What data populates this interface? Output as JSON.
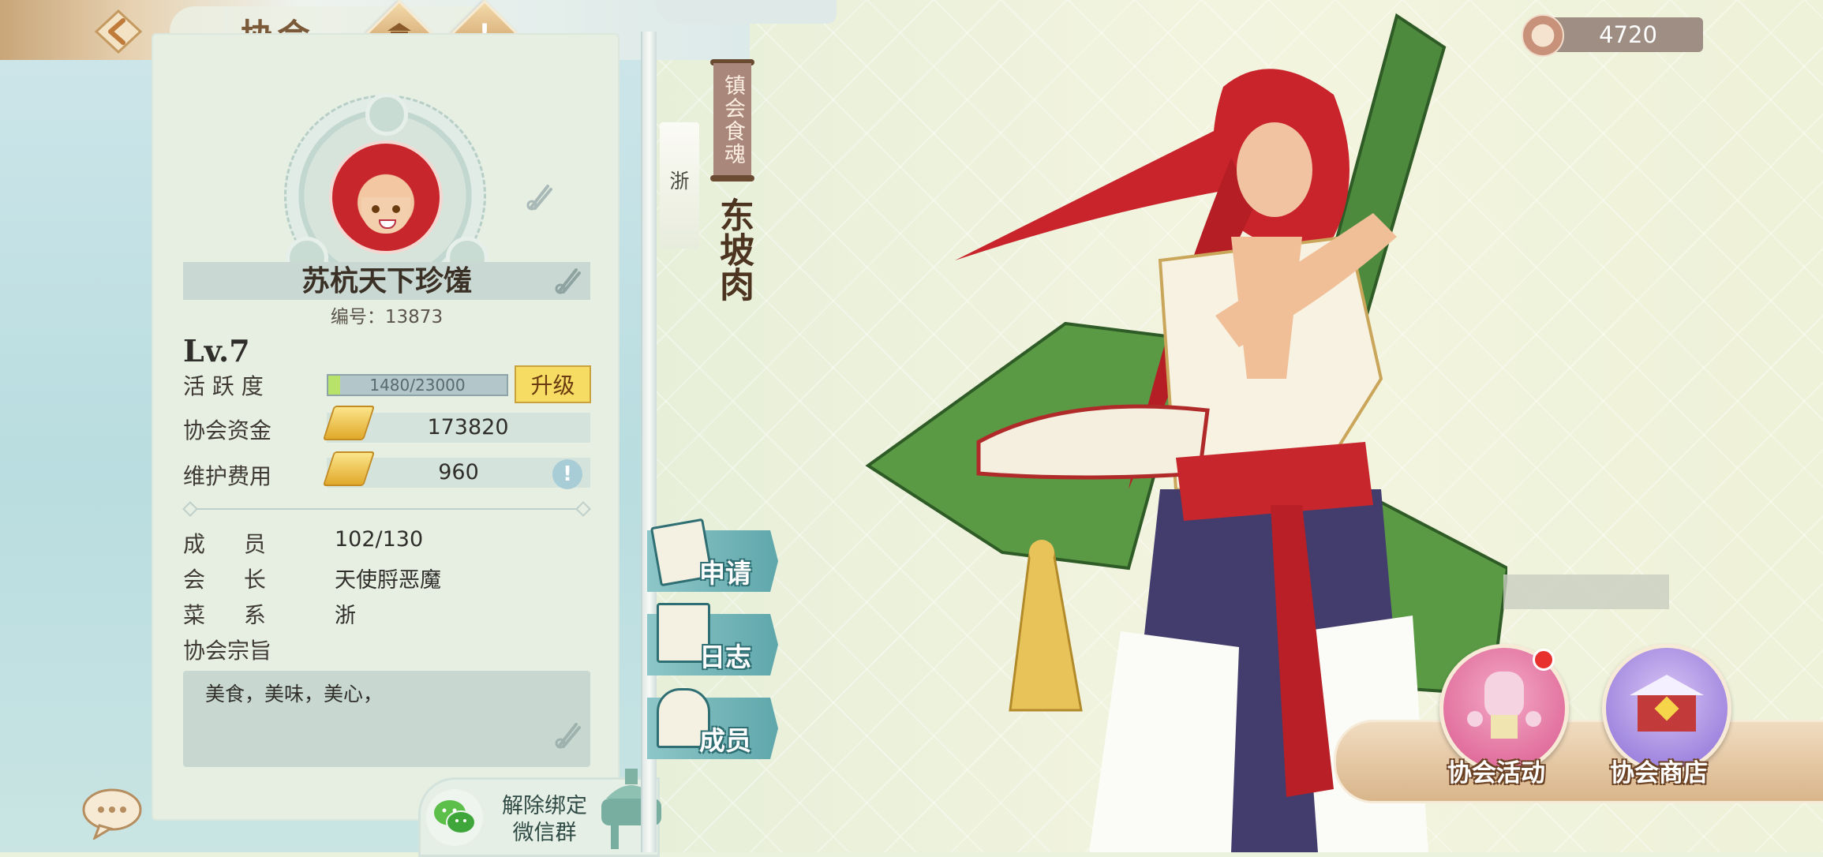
{
  "header": {
    "title": "协会"
  },
  "guild": {
    "name": "苏杭天下珍馐",
    "id_line": "编号：13873",
    "level": "Lv.7",
    "activity": {
      "label": "活 跃 度",
      "text": "1480/23000",
      "current": 1480,
      "max": 23000
    },
    "upgrade_label": "升级",
    "funds": {
      "label": "协会资金",
      "value": "173820"
    },
    "upkeep": {
      "label": "维护费用",
      "value": "960"
    },
    "members": {
      "label": "成 员",
      "value": "102/130"
    },
    "leader": {
      "label": "会 长",
      "value": "天使脟恶魔"
    },
    "cuisine": {
      "label": "菜 系",
      "value": "浙"
    },
    "motto": {
      "label": "协会宗旨",
      "value": "美食，美味，美心，"
    }
  },
  "wechat": {
    "line1": "解除绑定",
    "line2": "微信群"
  },
  "side_tabs": [
    {
      "label": "申请"
    },
    {
      "label": "日志"
    },
    {
      "label": "成员"
    }
  ],
  "soul": {
    "region": "浙",
    "title": "镇会食魂",
    "name": "东坡肉"
  },
  "currency": {
    "value": "4720"
  },
  "actions": [
    {
      "label": "协会活动"
    },
    {
      "label": "协会商店"
    }
  ],
  "colors": {
    "accent_teal": "#5fa7ab",
    "upgrade_yellow": "#f7dc63",
    "notification_red": "#e8312f",
    "panel_bg": "#e6efe1"
  },
  "icons": [
    "back-arrow-icon",
    "guild-hall-icon",
    "alert-icon",
    "edit-icon",
    "gold-ingot-icon",
    "info-icon",
    "wechat-icon",
    "chat-bubble-icon",
    "coin-icon"
  ]
}
